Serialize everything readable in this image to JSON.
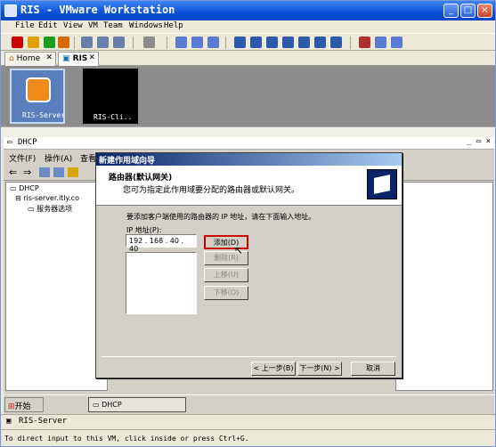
{
  "window": {
    "title": "RIS - VMware Workstation"
  },
  "menu": [
    "File",
    "Edit",
    "View",
    "VM",
    "Team",
    "Windows",
    "Help"
  ],
  "tabs": [
    {
      "label": "Home"
    },
    {
      "label": "RIS"
    }
  ],
  "vms": [
    {
      "label": "RIS-Server"
    },
    {
      "label": "RIS-Cli.."
    }
  ],
  "mmc": {
    "title": "DHCP",
    "menu": [
      "文件(F)",
      "操作(A)",
      "查看"
    ],
    "tree": [
      "DHCP",
      "ris-server.itly.co",
      "服务器选项"
    ]
  },
  "wizard": {
    "title": "新建作用域向导",
    "heading": "路由器(默认网关)",
    "subheading": "您可为指定此作用域要分配的路由器或默认网关。",
    "instruction": "要添加客户端使用的路由器的 IP 地址，请在下面输入地址。",
    "ip_label": "IP 地址(P):",
    "ip_value": "192 . 168 . 40 . 40",
    "add": "添加(D)",
    "remove": "删除(R)",
    "up": "上移(U)",
    "down": "下移(O)",
    "back": "< 上一步(B)",
    "next": "下一步(N) >",
    "cancel": "取消"
  },
  "guest_taskbar": {
    "start": "开始",
    "item": "DHCP"
  },
  "status": {
    "vm": "RIS-Server"
  },
  "hint": "To direct input to this VM, click inside or press Ctrl+G.",
  "colors": {
    "titlebar": "#0a4fd6",
    "dialog_title": "#0a246a",
    "highlight": "#cc0000"
  }
}
